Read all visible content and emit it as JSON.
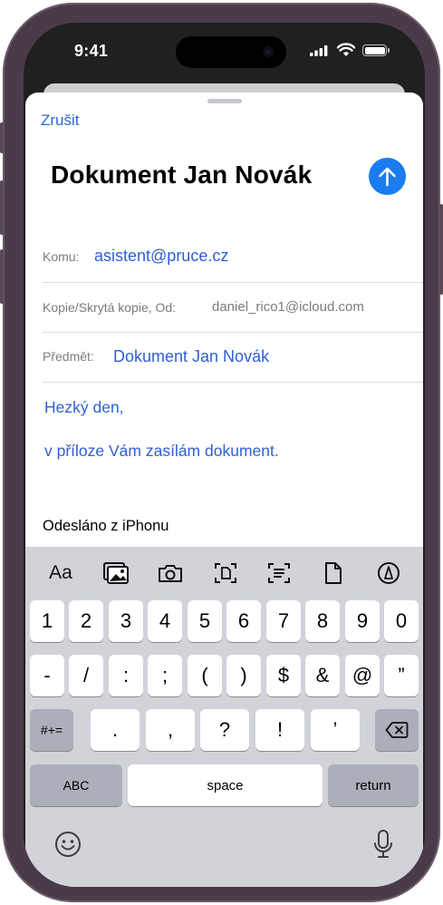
{
  "status": {
    "time": "9:41"
  },
  "mail": {
    "cancel": "Zrušit",
    "title": "Dokument Jan Novák",
    "to_label": "Komu:",
    "to_value": "asistent@pruce.cz",
    "cc_label": "Kopie/Skrytá kopie, Od:",
    "cc_value": "daniel_rico1@icloud.com",
    "subject_label": "Předmět:",
    "subject_value": "Dokument Jan Novák",
    "body_line1": "Hezký den,",
    "body_line2": "v příloze Vám zasílám dokument.",
    "signature": "Odesláno z iPhonu"
  },
  "toolbar": {
    "format_label": "Aa",
    "icons": [
      "photo-library-icon",
      "camera-icon",
      "scan-document-icon",
      "scan-text-icon",
      "attach-file-icon",
      "markup-icon"
    ]
  },
  "keyboard": {
    "row1": [
      "1",
      "2",
      "3",
      "4",
      "5",
      "6",
      "7",
      "8",
      "9",
      "0"
    ],
    "row2": [
      "-",
      "/",
      ":",
      ";",
      "(",
      ")",
      "$",
      "&",
      "@",
      "”"
    ],
    "row3_toggle": "#+=",
    "row3": [
      ".",
      ",",
      "?",
      "!",
      "’"
    ],
    "abc": "ABC",
    "space": "space",
    "return": "return"
  },
  "colors": {
    "accent": "#2e66d8",
    "send": "#1a7cf0",
    "keyboard_bg": "#d1d3d9"
  }
}
